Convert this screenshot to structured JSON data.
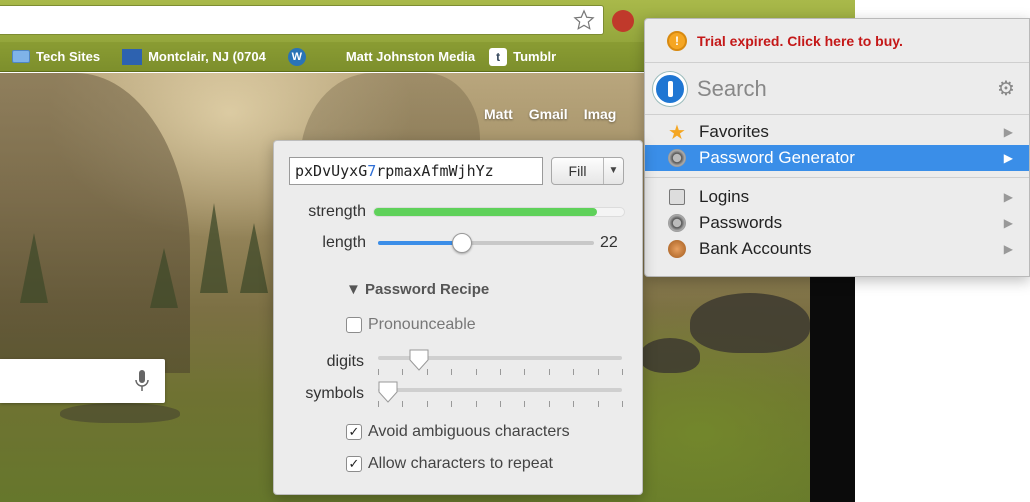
{
  "bookmarks": [
    {
      "label": "Tech Sites",
      "icon": "folder-icon"
    },
    {
      "label": "Montclair, NJ (0704",
      "icon": "weather-channel-icon"
    },
    {
      "label": "",
      "icon": "wordpress-icon"
    },
    {
      "label": "Matt Johnston Media",
      "icon": "none"
    },
    {
      "label": "Tumblr",
      "icon": "tumblr-icon"
    }
  ],
  "google": {
    "links": [
      "Matt",
      "Gmail",
      "Imag"
    ]
  },
  "onepassword": {
    "trial_message": "Trial expired. Click here to buy.",
    "search_placeholder": "Search",
    "menu": [
      {
        "label": "Favorites",
        "icon": "star-icon",
        "selected": false
      },
      {
        "label": "Password Generator",
        "icon": "dial-icon",
        "selected": true
      },
      {
        "label": "Logins",
        "icon": "key-icon",
        "selected": false
      },
      {
        "label": "Passwords",
        "icon": "dial-icon",
        "selected": false
      },
      {
        "label": "Bank Accounts",
        "icon": "bank-icon",
        "selected": false
      }
    ]
  },
  "generator": {
    "password_before": "pxDvUyxG",
    "password_digit": "7",
    "password_after": "rpmaxAfmWjhYz",
    "fill_label": "Fill",
    "strength_label": "strength",
    "strength_fraction": 0.89,
    "length_label": "length",
    "length_value": "22",
    "length_fraction": 0.39,
    "recipe_label": "▼ Password Recipe",
    "pronounceable_label": "Pronounceable",
    "pronounceable_checked": false,
    "digits_label": "digits",
    "digits_fraction": 0.13,
    "symbols_label": "symbols",
    "symbols_fraction": 0.0,
    "avoid_ambiguous_label": "Avoid ambiguous characters",
    "avoid_ambiguous_checked": true,
    "allow_repeat_label": "Allow characters to repeat",
    "allow_repeat_checked": true
  },
  "colors": {
    "accent": "#3a8ee8",
    "trial": "#c41818",
    "strength": "#5fd15a"
  }
}
